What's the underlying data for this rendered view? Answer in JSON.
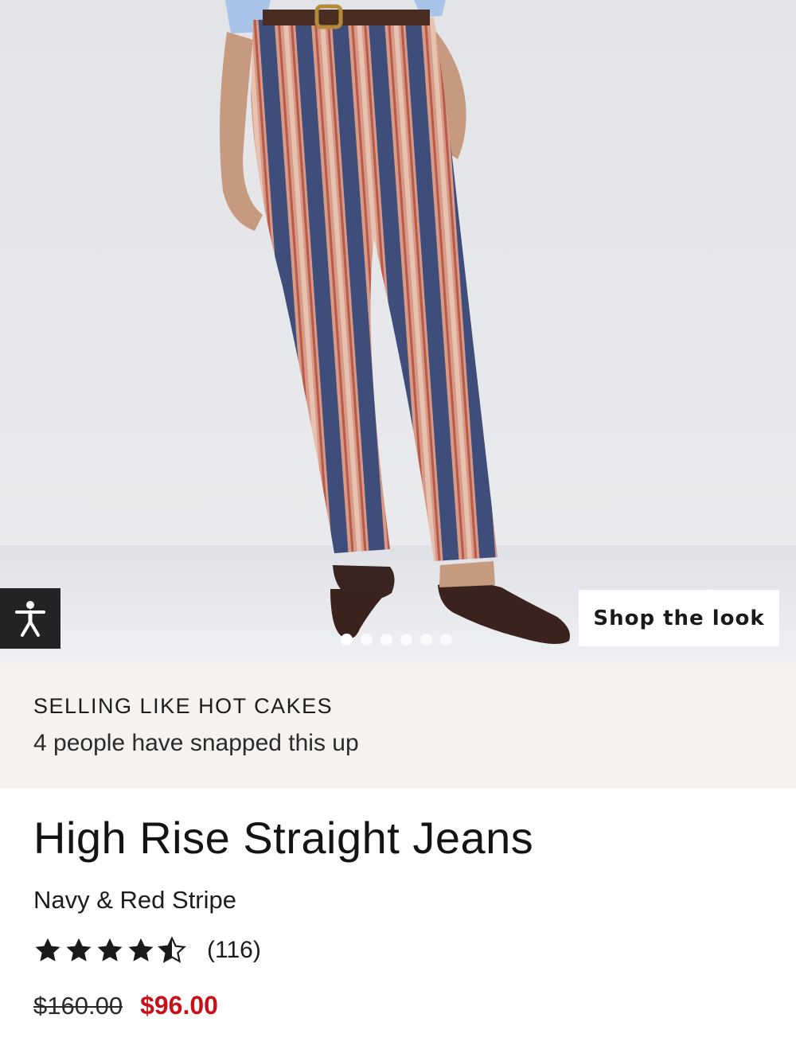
{
  "hero": {
    "shop_the_look_label": "Shop the look",
    "accessibility_icon": "accessibility-person-icon",
    "carousel": {
      "total": 6,
      "active_index": 0
    }
  },
  "promo": {
    "title": "SELLING LIKE HOT CAKES",
    "subtitle": "4 people have snapped this up"
  },
  "product": {
    "title": "High Rise Straight Jeans",
    "color_name": "Navy & Red Stripe",
    "rating": 4.5,
    "rating_max": 5,
    "review_count": "(116)",
    "original_price": "$160.00",
    "sale_price": "$96.00"
  },
  "colors": {
    "sale_red": "#c8101a",
    "promo_bg": "#f5f2ef",
    "stripe_navy": "#3f4d7a",
    "stripe_red": "#c98472"
  }
}
